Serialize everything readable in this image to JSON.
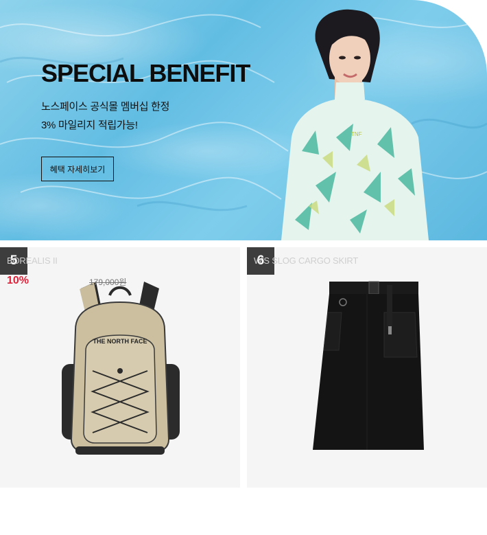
{
  "banner": {
    "title": "SPECIAL BENEFIT",
    "line1": "노스페이스 공식몰 멤버십 한정",
    "line2": "3% 마일리지 적립가능!",
    "button_label": "혜택 자세히보기"
  },
  "products": [
    {
      "rank": "5",
      "name": "BOREALIS II",
      "discount": "10%",
      "original_price": "179,000원"
    },
    {
      "rank": "6",
      "name": "W'S SLOG CARGO SKIRT",
      "discount": "",
      "original_price": ""
    }
  ],
  "colors": {
    "banner_water": "#62bde3",
    "rank_badge": "#3d3d3d",
    "discount": "#e0223a",
    "card_bg": "#f5f5f5"
  },
  "backpack_logo": "THE NORTH FACE"
}
